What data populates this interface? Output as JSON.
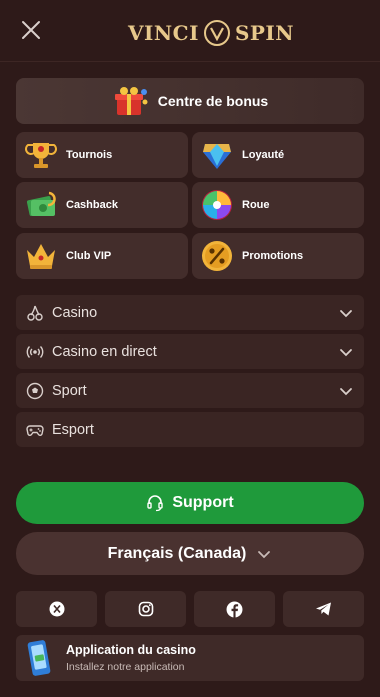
{
  "header": {
    "logo_left": "VINCI",
    "logo_right": "SPIN"
  },
  "bonus": {
    "label": "Centre de bonus"
  },
  "tiles": [
    {
      "label": "Tournois",
      "icon": "trophy-icon"
    },
    {
      "label": "Loyauté",
      "icon": "diamond-icon"
    },
    {
      "label": "Cashback",
      "icon": "cash-icon"
    },
    {
      "label": "Roue",
      "icon": "wheel-icon"
    },
    {
      "label": "Club VIP",
      "icon": "crown-icon"
    },
    {
      "label": "Promotions",
      "icon": "percent-icon"
    }
  ],
  "menu": [
    {
      "label": "Casino",
      "icon": "cherries-icon",
      "expandable": true
    },
    {
      "label": "Casino en direct",
      "icon": "broadcast-icon",
      "expandable": true
    },
    {
      "label": "Sport",
      "icon": "soccer-ball-icon",
      "expandable": true
    },
    {
      "label": "Esport",
      "icon": "gamepad-icon",
      "expandable": false
    }
  ],
  "support": {
    "label": "Support"
  },
  "language": {
    "label": "Français (Canada)"
  },
  "socials": [
    "x-icon",
    "instagram-icon",
    "facebook-icon",
    "telegram-icon"
  ],
  "app": {
    "title": "Application du casino",
    "subtitle": "Installez notre application"
  },
  "colors": {
    "background": "#2e1a19",
    "support_green": "#1f9a3b",
    "logo_gold": "#e7c88b"
  }
}
